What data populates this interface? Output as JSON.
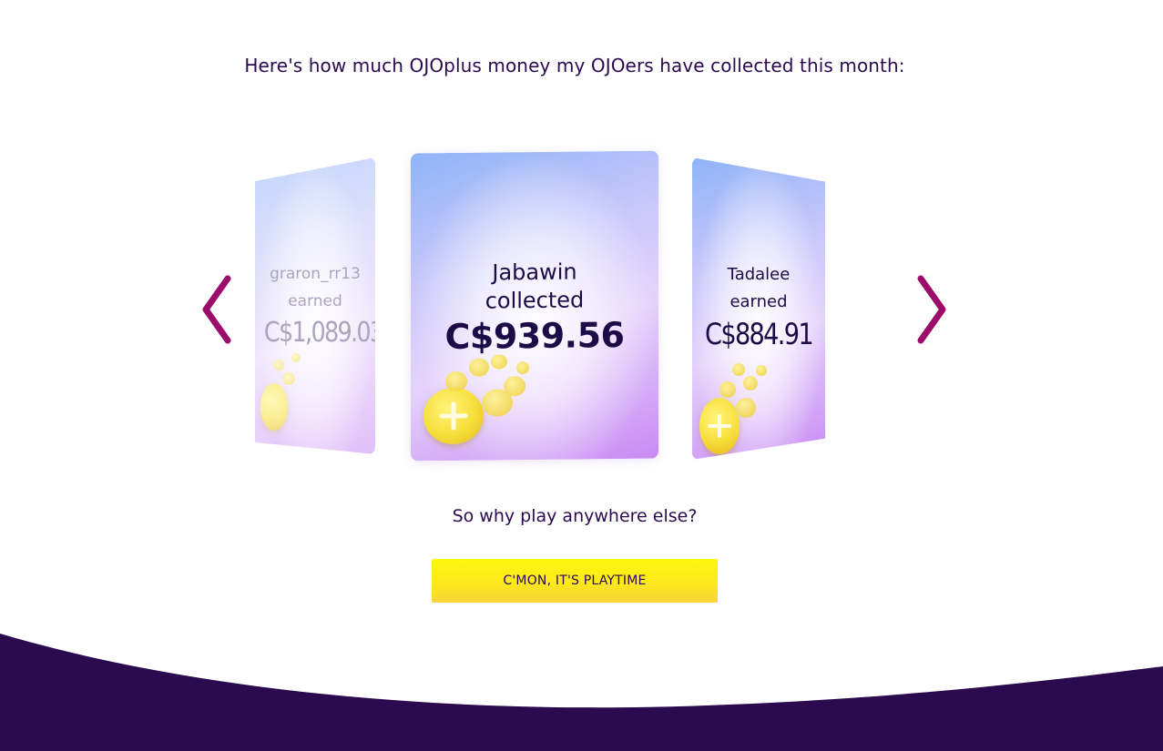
{
  "headline": "Here's how much OJOplus money my OJOers have collected this month:",
  "carousel": {
    "cards": [
      {
        "name": "graron_rr13",
        "verb": "earned",
        "amount": "C$1,089.03"
      },
      {
        "name": "Jabawin",
        "verb": "collected",
        "amount": "C$939.56"
      },
      {
        "name": "Tadalee",
        "verb": "earned",
        "amount": "C$884.91"
      }
    ],
    "prev_icon": "chevron-left-icon",
    "next_icon": "chevron-right-icon"
  },
  "question": "So why play anywhere else?",
  "cta_label": "C'MON, IT'S PLAYTIME",
  "colors": {
    "text": "#2b0a4f",
    "arrow": "#9c0d6b",
    "cta": "#fdf01a",
    "footer": "#2b0a4f"
  }
}
